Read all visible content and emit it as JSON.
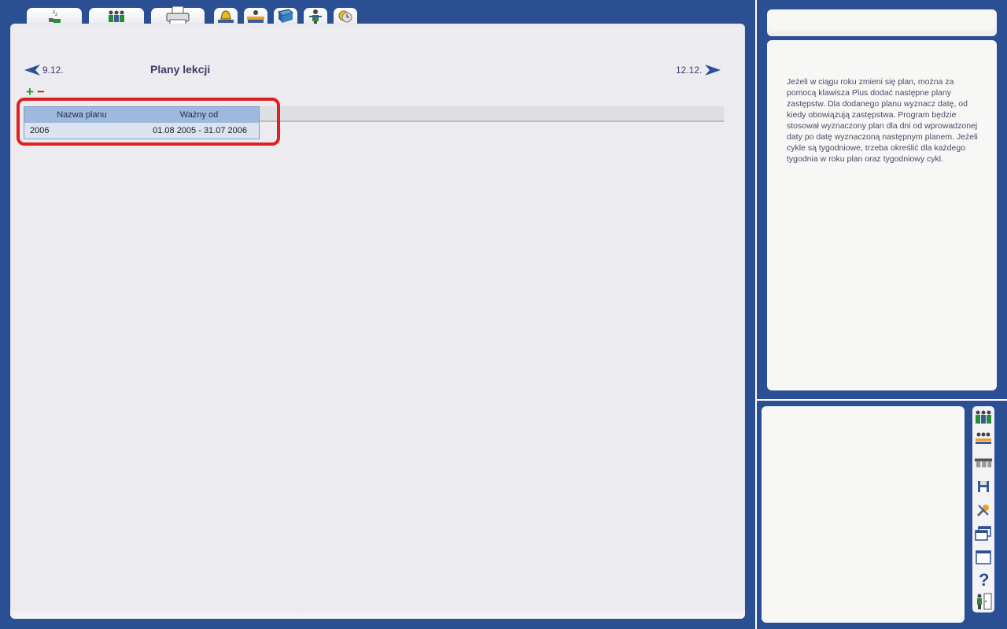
{
  "nav": {
    "prev_label": "9.12.",
    "next_label": "12.12."
  },
  "page": {
    "title": "Plany lekcji"
  },
  "table": {
    "columns": [
      "Nazwa planu",
      "Ważny od"
    ],
    "rows": [
      [
        "2006",
        "01.08 2005 - 31.07 2006"
      ]
    ]
  },
  "help": {
    "text": "Jeżeli w ciągu roku zmieni się plan, można za pomocą klawisza Plus dodać następne plany zastępstw. Dla dodanego planu wyznacz datę, od kiedy obowiązują zastępstwa. Program będzie stosował wyznaczony plan dla dni od wprowadzonej daty po datę wyznaczoną następnym planem. Jeżeli cykle są tygodniowe, trzeba określić dla każdego tygodnia w roku plan oraz tygodniowy cykl."
  },
  "tabs": [
    "sleep-icon",
    "teachers-icon",
    "printer-icon",
    "bell-icon",
    "desk-icon",
    "book-icon",
    "teacher-icon",
    "clock-icon"
  ],
  "toolbar": [
    "teachers-icon",
    "classes-icon",
    "rooms-icon",
    "save-icon",
    "tools-icon",
    "windows-icon",
    "window-icon",
    "help-icon",
    "exit-icon"
  ],
  "colors": {
    "background": "#2b4f93",
    "accent": "#3c3c6c",
    "highlight": "#e02020",
    "plus": "#2a9a2a",
    "minus": "#c8202a"
  }
}
